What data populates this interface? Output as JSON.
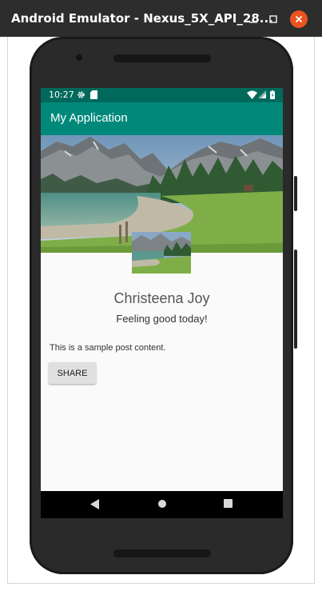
{
  "window": {
    "title": "Android Emulator - Nexus_5X_API_28..."
  },
  "status_bar": {
    "time": "10:27",
    "icons": [
      "settings-gear-icon",
      "sd-card-icon",
      "wifi-icon",
      "cell-signal-icon",
      "battery-icon"
    ]
  },
  "app_bar": {
    "title": "My Application",
    "color": "#00897b"
  },
  "profile": {
    "name": "Christeena Joy",
    "status": "Feeling good today!"
  },
  "post": {
    "content": "This is a sample post content.",
    "share_label": "SHARE"
  },
  "nav_bar": {
    "icons": [
      "back-icon",
      "home-icon",
      "recents-icon"
    ]
  },
  "colors": {
    "status_bar": "#00695c",
    "app_bar": "#00897b",
    "close_button": "#e95420"
  }
}
